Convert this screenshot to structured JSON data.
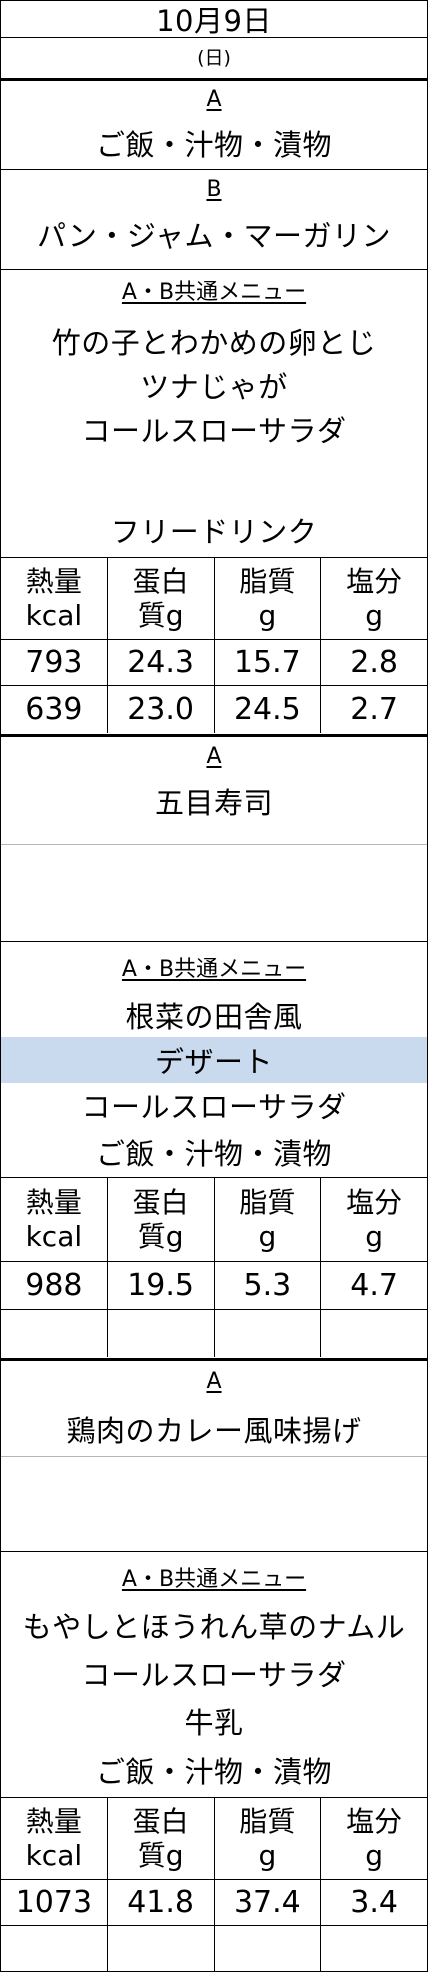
{
  "header": {
    "date": "10月9日",
    "weekday": "(日)"
  },
  "nutrition_headers": [
    {
      "line1": "熱量",
      "line2": "kcal"
    },
    {
      "line1": "蛋白",
      "line2": "質g"
    },
    {
      "line1": "脂質",
      "line2": "g"
    },
    {
      "line1": "塩分",
      "line2": "g"
    }
  ],
  "breakfast": {
    "a_label": "A",
    "a_item": "ご飯・汁物・漬物",
    "b_label": "B",
    "b_item": "パン・ジャム・マーガリン",
    "common_label": "A・B共通メニュー",
    "common_items": [
      "竹の子とわかめの卵とじ",
      "ツナじゃが",
      "コールスローサラダ",
      "",
      "フリードリンク"
    ],
    "nutrition": [
      [
        "793",
        "24.3",
        "15.7",
        "2.8"
      ],
      [
        "639",
        "23.0",
        "24.5",
        "2.7"
      ]
    ]
  },
  "lunch": {
    "a_label": "A",
    "a_item": "五目寿司",
    "common_label": "A・B共通メニュー",
    "common_items": [
      "根菜の田舎風",
      "デザート",
      "コールスローサラダ",
      "ご飯・汁物・漬物"
    ],
    "nutrition": [
      [
        "988",
        "19.5",
        "5.3",
        "4.7"
      ],
      [
        "",
        "",
        "",
        ""
      ]
    ]
  },
  "dinner": {
    "a_label": "A",
    "a_item": "鶏肉のカレー風味揚げ",
    "common_label": "A・B共通メニュー",
    "common_items": [
      "もやしとほうれん草のナムル",
      "コールスローサラダ",
      "牛乳",
      "ご飯・汁物・漬物"
    ],
    "nutrition": [
      [
        "1073",
        "41.8",
        "37.4",
        "3.4"
      ],
      [
        "",
        "",
        "",
        ""
      ]
    ]
  }
}
